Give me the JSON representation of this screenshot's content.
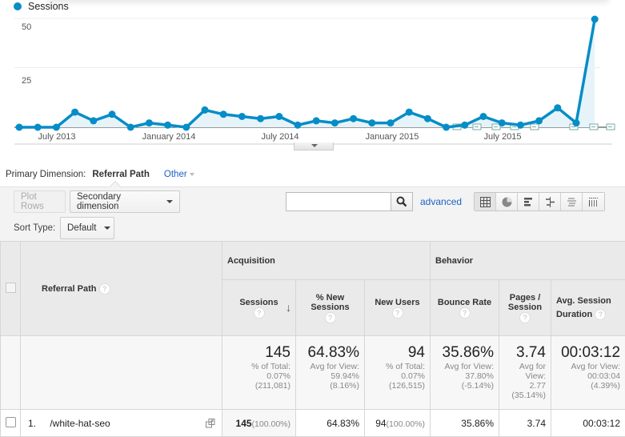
{
  "chart": {
    "legend_label": "Sessions",
    "series_color": "#058dc7"
  },
  "chart_data": {
    "type": "area",
    "title": "",
    "series": [
      {
        "name": "Sessions",
        "values": [
          0,
          0,
          0,
          7,
          3,
          6,
          0,
          2,
          1,
          0,
          8,
          6,
          5,
          4,
          5,
          1,
          3,
          2,
          4,
          2,
          2,
          7,
          4,
          0,
          1,
          5,
          2,
          1,
          3,
          9,
          2,
          50
        ]
      }
    ],
    "x_tick_labels": [
      "July 2013",
      "January 2014",
      "July 2014",
      "January 2015",
      "July 2015"
    ],
    "y_ticks": [
      25,
      50
    ],
    "ylim": [
      0,
      50
    ],
    "grid": true,
    "legend": "top-left",
    "annotation_markers": 10
  },
  "primary_dimension": {
    "label": "Primary Dimension:",
    "value": "Referral Path",
    "other": "Other"
  },
  "toolbar": {
    "plot_rows": "Plot Rows",
    "secondary_dimension": "Secondary dimension",
    "sort_type_label": "Sort Type:",
    "sort_type_value": "Default",
    "search_value": "",
    "advanced": "advanced"
  },
  "table": {
    "dimension_header": "Referral Path",
    "group_acquisition": "Acquisition",
    "group_behavior": "Behavior",
    "columns": [
      {
        "label": "Sessions"
      },
      {
        "label": "% New Sessions"
      },
      {
        "label": "New Users"
      },
      {
        "label": "Bounce Rate"
      },
      {
        "label": "Pages / Session"
      },
      {
        "label": "Avg. Session Duration"
      }
    ],
    "totals": [
      {
        "value": "145",
        "l1": "% of Total:",
        "l2": "0.07%",
        "l3": "(211,081)",
        "l4": ""
      },
      {
        "value": "64.83%",
        "l1": "Avg for View:",
        "l2": "59.94%",
        "l3": "(8.16%)",
        "l4": ""
      },
      {
        "value": "94",
        "l1": "% of Total:",
        "l2": "0.07%",
        "l3": "(126,515)",
        "l4": ""
      },
      {
        "value": "35.86%",
        "l1": "Avg for View:",
        "l2": "37.80%",
        "l3": "(-5.14%)",
        "l4": ""
      },
      {
        "value": "3.74",
        "l1": "Avg for",
        "l2": "View:",
        "l3": "2.77",
        "l4": "(35.14%)"
      },
      {
        "value": "00:03:12",
        "l1": "Avg for View:",
        "l2": "00:03:04",
        "l3": "(4.39%)",
        "l4": ""
      }
    ],
    "rows": [
      {
        "index": "1.",
        "path": "/white-hat-seo",
        "sessions": "145",
        "sessions_pct": "(100.00%)",
        "new_sessions_pct": "64.83%",
        "new_users": "94",
        "new_users_pct": "(100.00%)",
        "bounce_rate": "35.86%",
        "pages_session": "3.74",
        "avg_duration": "00:03:12"
      }
    ]
  }
}
